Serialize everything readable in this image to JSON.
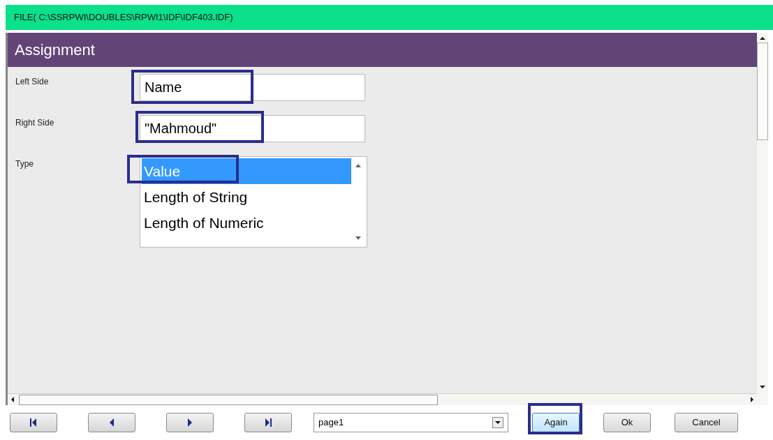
{
  "file_bar": {
    "path": "FILE( C:\\SSRPWI\\DOUBLES\\RPWI1\\IDF\\IDF403.IDF)"
  },
  "panel": {
    "title": "Assignment"
  },
  "fields": [
    {
      "label": "Left Side",
      "value": "Name",
      "highlighted": true
    },
    {
      "label": "Right Side",
      "value": "\"Mahmoud\"",
      "highlighted": true
    }
  ],
  "type_list": {
    "label": "Type",
    "options": [
      {
        "text": "Value",
        "selected": true,
        "highlighted": true
      },
      {
        "text": "Length of String",
        "selected": false,
        "highlighted": false
      },
      {
        "text": "Length of Numeric",
        "selected": false,
        "highlighted": false
      }
    ]
  },
  "nav_buttons": [
    {
      "kind": "first"
    },
    {
      "kind": "prev"
    },
    {
      "kind": "next"
    },
    {
      "kind": "last"
    }
  ],
  "page_select": {
    "value": "page1"
  },
  "buttons": [
    {
      "label": "Again",
      "highlighted": true,
      "active": true
    },
    {
      "label": "Ok",
      "highlighted": false,
      "active": false
    },
    {
      "label": "Cancel",
      "highlighted": false,
      "active": false
    }
  ]
}
